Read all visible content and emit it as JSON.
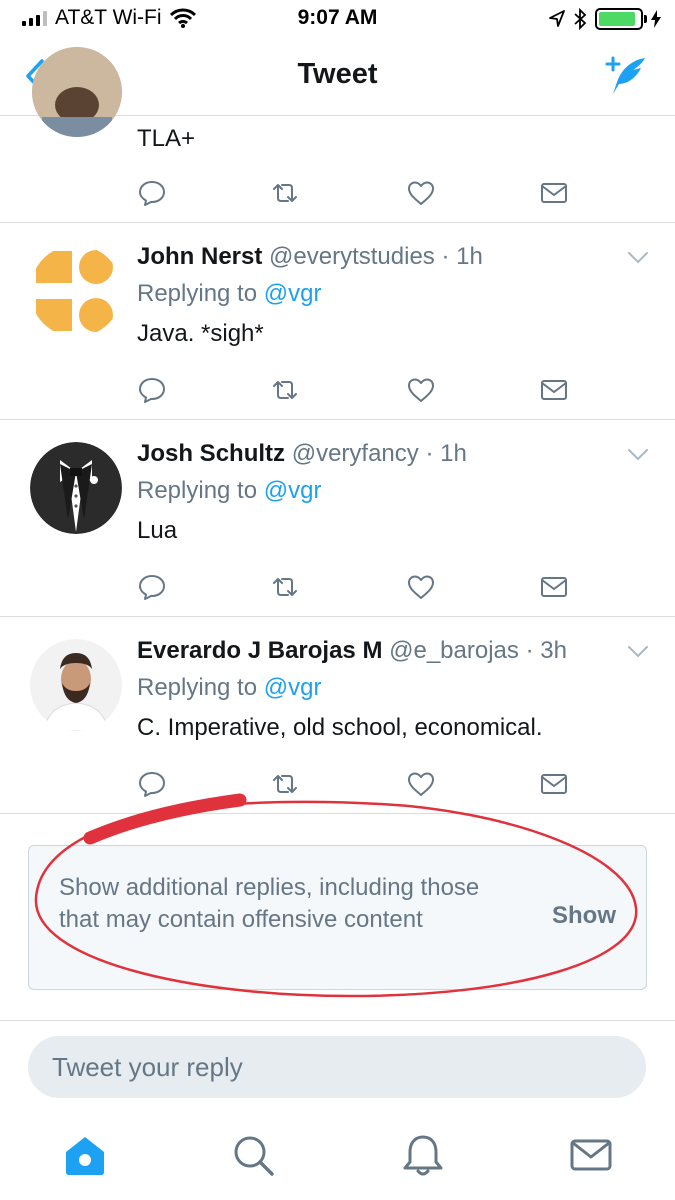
{
  "status_bar": {
    "carrier": "AT&T Wi-Fi",
    "time": "9:07 AM",
    "battery_level": 0.9
  },
  "nav": {
    "title": "Tweet",
    "back_icon": "chevron-left-icon",
    "compose_icon": "compose-tweet-icon"
  },
  "partial_tweet": {
    "text": "TLA+"
  },
  "tweets": [
    {
      "name": "John Nerst",
      "handle": "@everytstudies",
      "time": "1h",
      "replying_prefix": "Replying to",
      "mention": "@vgr",
      "text": "Java. *sigh*"
    },
    {
      "name": "Josh Schultz",
      "handle": "@veryfancy",
      "time": "1h",
      "replying_prefix": "Replying to",
      "mention": "@vgr",
      "text": "Lua"
    },
    {
      "name": "Everardo J Barojas M",
      "handle": "@e_barojas",
      "time": "3h",
      "replying_prefix": "Replying to",
      "mention": "@vgr",
      "text": "C. Imperative, old school, economical."
    }
  ],
  "additional_replies": {
    "message": "Show additional replies, including those that may contain offensive content",
    "action": "Show"
  },
  "reply_box": {
    "placeholder": "Tweet your reply"
  },
  "colors": {
    "accent": "#1da1f2",
    "muted": "#657786",
    "annotation": "#e0323c"
  },
  "tab_bar": {
    "icons": [
      "home-icon",
      "search-icon",
      "notifications-icon",
      "messages-icon"
    ],
    "active": "home-icon"
  }
}
